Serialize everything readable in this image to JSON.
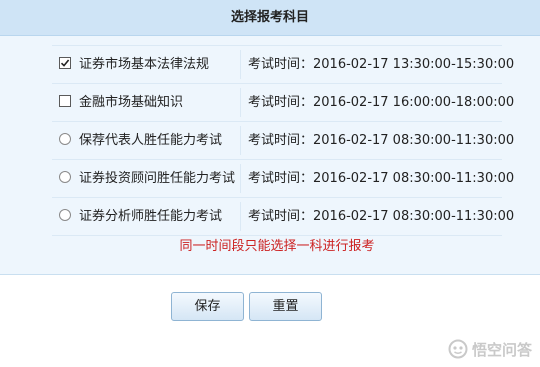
{
  "header": {
    "title": "选择报考科目"
  },
  "subjects": [
    {
      "control": "checkbox",
      "checked": true,
      "name": "证券市场基本法律法规",
      "time": "考试时间：2016-02-17 13:30:00-15:30:00"
    },
    {
      "control": "checkbox",
      "checked": false,
      "name": "金融市场基础知识",
      "time": "考试时间：2016-02-17 16:00:00-18:00:00"
    },
    {
      "control": "radio",
      "checked": false,
      "name": "保荐代表人胜任能力考试",
      "time": "考试时间：2016-02-17 08:30:00-11:30:00"
    },
    {
      "control": "radio",
      "checked": false,
      "name": "证券投资顾问胜任能力考试",
      "time": "考试时间：2016-02-17 08:30:00-11:30:00"
    },
    {
      "control": "radio",
      "checked": false,
      "name": "证券分析师胜任能力考试",
      "time": "考试时间：2016-02-17 08:30:00-11:30:00"
    }
  ],
  "notice": "同一时间段只能选择一科进行报考",
  "buttons": {
    "save_label": "保存",
    "reset_label": "重置"
  },
  "watermark": {
    "text": "悟空问答"
  },
  "colors": {
    "panel_bg": "#eef6fd",
    "header_bg": "#cfe4f6",
    "notice_text": "#cc2222",
    "button_border": "#8fb4d3"
  }
}
